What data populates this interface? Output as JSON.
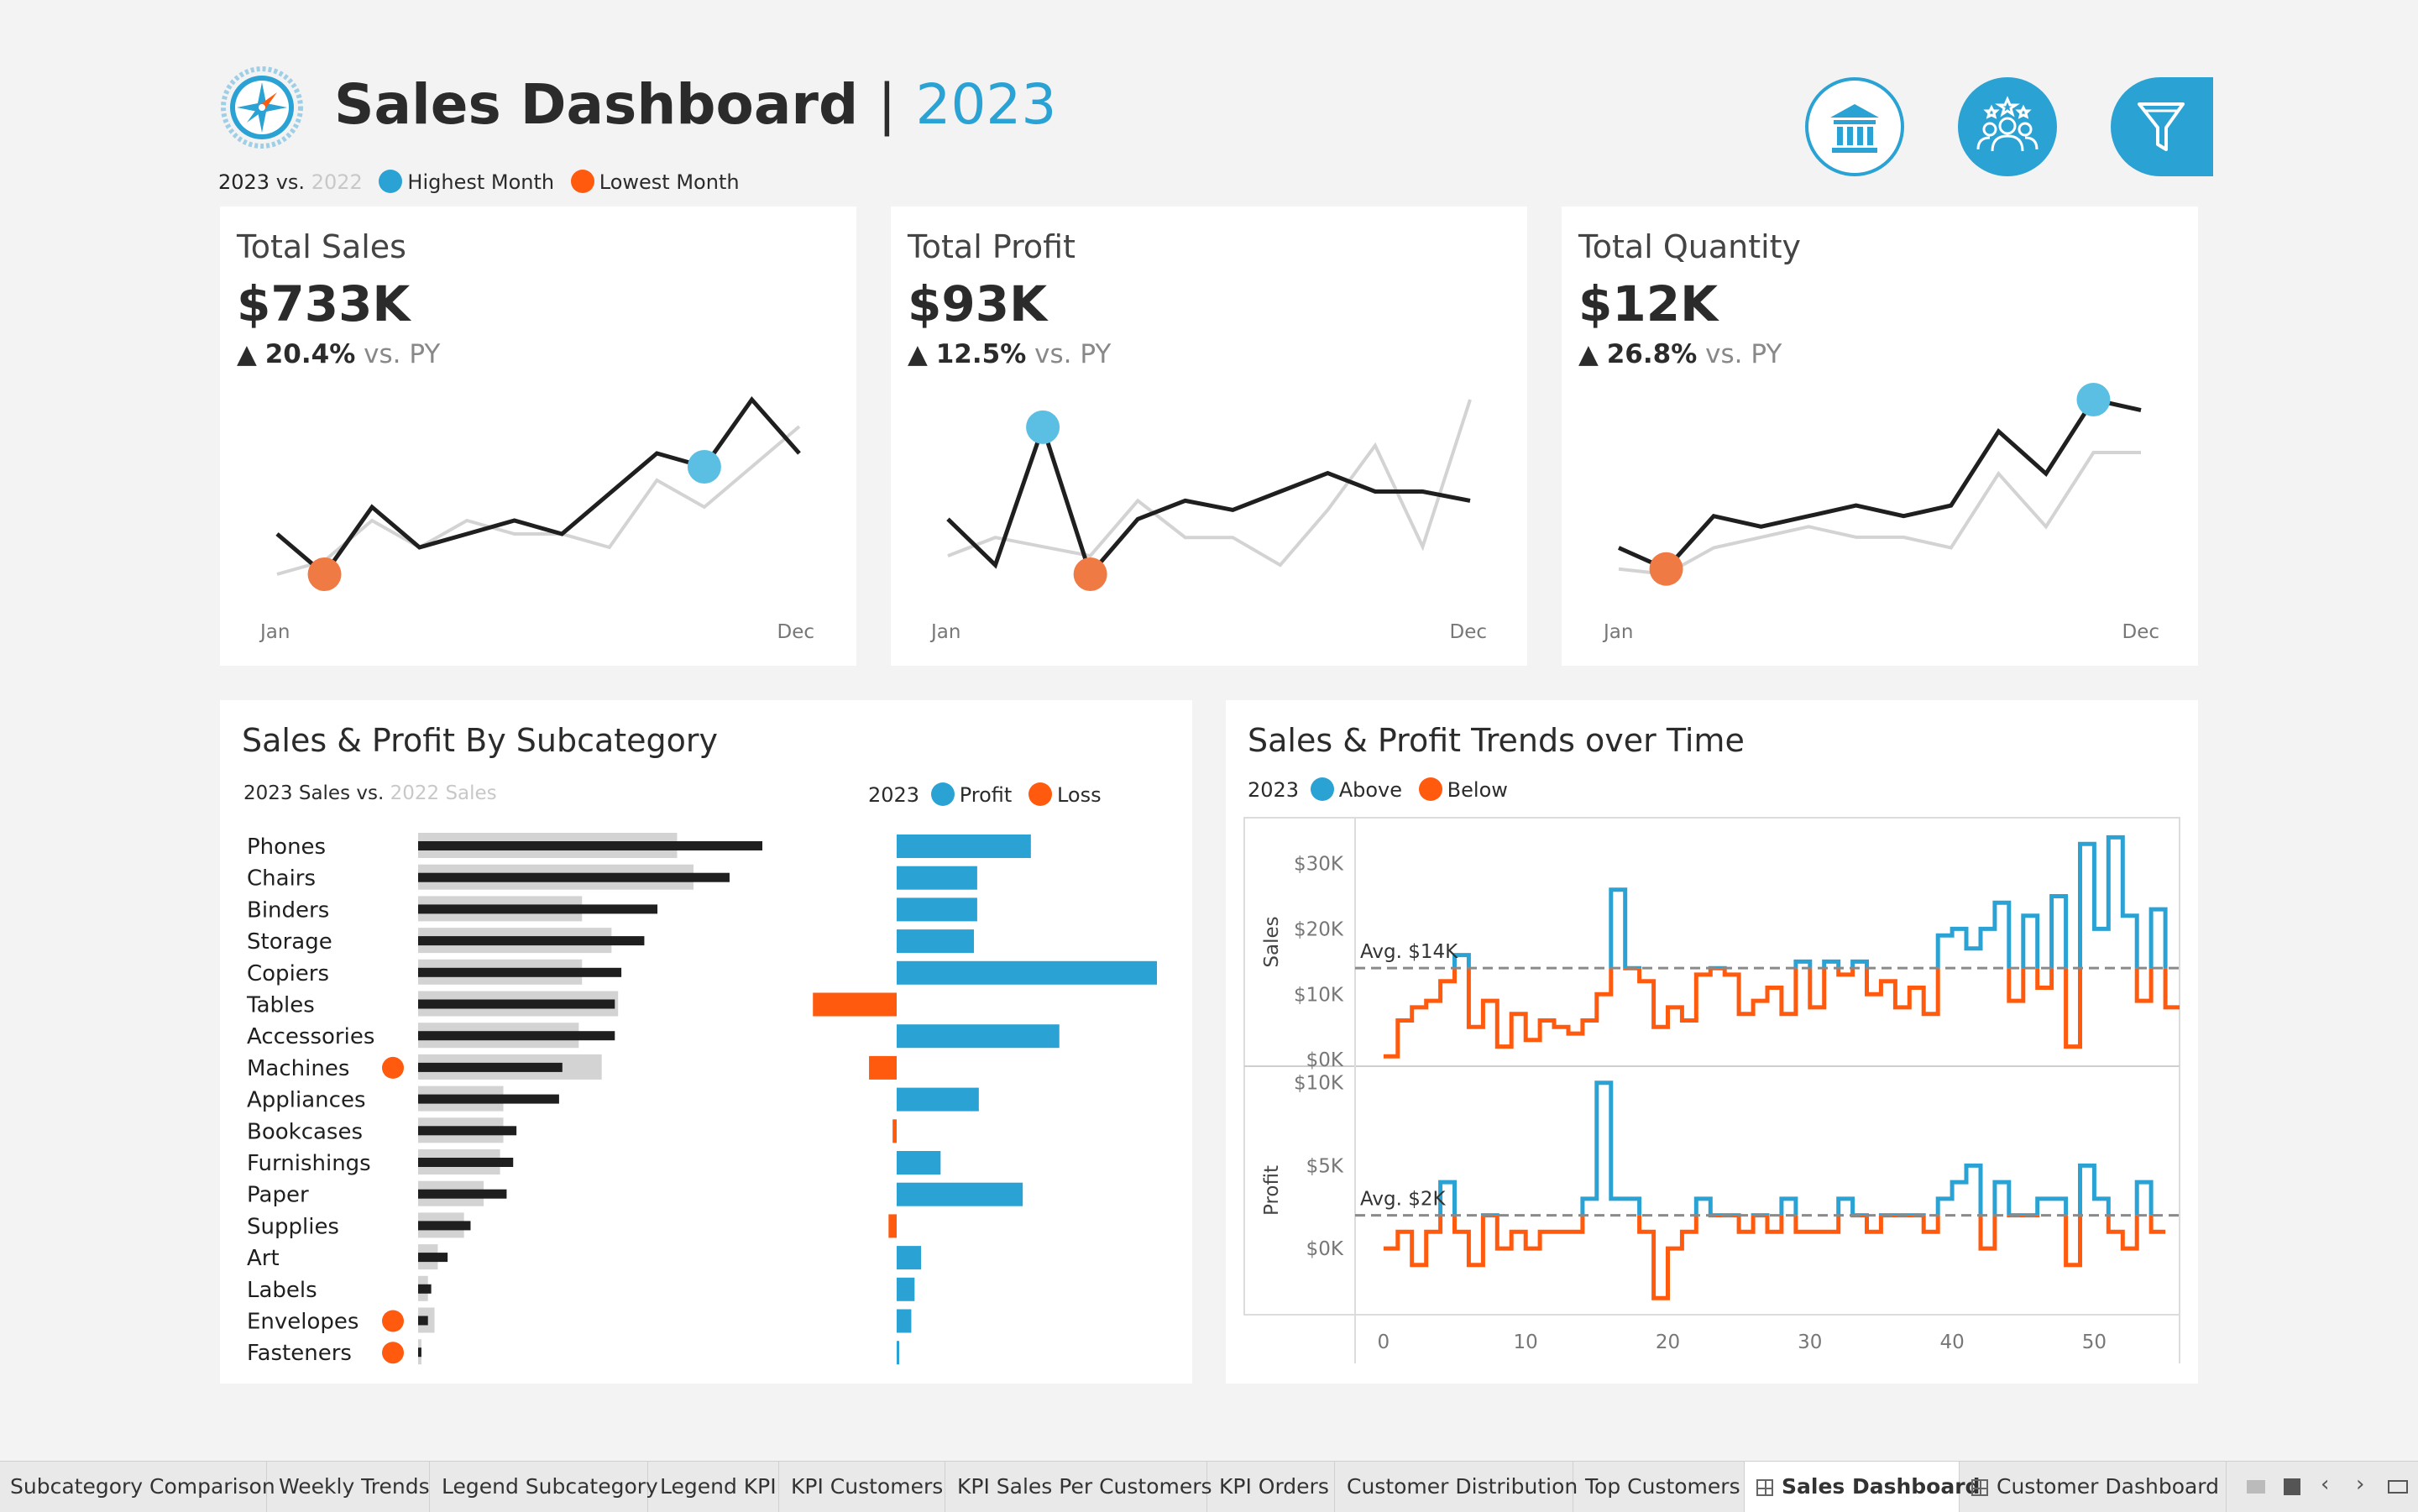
{
  "header": {
    "title": "Sales Dashboard",
    "separator": "|",
    "year": "2023",
    "legend": {
      "current": "2023",
      "vs": "vs.",
      "previous": "2022",
      "highest": "Highest Month",
      "lowest": "Lowest Month"
    }
  },
  "colors": {
    "accent": "#2ba2d4",
    "highlight_blue": "#5bbfe3",
    "loss_orange": "#ff5a0e",
    "low_orange": "#f07a43",
    "prev_gray": "#d3d3d3",
    "current_black": "#1f1f1f"
  },
  "nav_icons": [
    "bank-icon",
    "customers-icon",
    "filter-icon"
  ],
  "kpis": [
    {
      "title": "Total Sales",
      "value": "$733K",
      "arrow": "▲",
      "change": "20.4%",
      "vs": "vs. PY",
      "start": "Jan",
      "end": "Dec",
      "current": [
        4,
        1,
        6,
        3,
        4,
        5,
        4,
        7,
        10,
        9,
        14,
        10
      ],
      "previous": [
        1,
        2,
        5,
        3,
        5,
        4,
        4,
        3,
        8,
        6,
        9,
        12
      ],
      "high_index": 9,
      "low_index": 1
    },
    {
      "title": "Total Profit",
      "value": "$93K",
      "arrow": "▲",
      "change": "12.5%",
      "vs": "vs. PY",
      "start": "Jan",
      "end": "Dec",
      "current": [
        7,
        2,
        17,
        1,
        7,
        9,
        8,
        10,
        12,
        10,
        10,
        9
      ],
      "previous": [
        3,
        5,
        4,
        3,
        9,
        5,
        5,
        2,
        8,
        15,
        4,
        20
      ],
      "high_index": 2,
      "low_index": 3
    },
    {
      "title": "Total Quantity",
      "value": "$12K",
      "arrow": "▲",
      "change": "26.8%",
      "vs": "vs. PY",
      "start": "Jan",
      "end": "Dec",
      "current": [
        3,
        1,
        6,
        5,
        6,
        7,
        6,
        7,
        14,
        10,
        17,
        16
      ],
      "previous": [
        1,
        0.5,
        3,
        4,
        5,
        4,
        4,
        3,
        10,
        5,
        12,
        12
      ],
      "high_index": 10,
      "low_index": 1
    }
  ],
  "subcategory_panel": {
    "title": "Sales & Profit By Subcategory",
    "legend_left": {
      "current": "2023 Sales",
      "vs": "vs.",
      "previous": "2022 Sales"
    },
    "legend_right": {
      "year": "2023",
      "profit": "Profit",
      "loss": "Loss"
    }
  },
  "chart_data": [
    {
      "type": "bar",
      "title": "Sales & Profit By Subcategory",
      "categories": [
        "Phones",
        "Chairs",
        "Binders",
        "Storage",
        "Copiers",
        "Tables",
        "Accessories",
        "Machines",
        "Appliances",
        "Bookcases",
        "Furnishings",
        "Paper",
        "Supplies",
        "Art",
        "Labels",
        "Envelopes",
        "Fasteners"
      ],
      "series": [
        {
          "name": "2023 Sales",
          "values": [
            105,
            95,
            73,
            69,
            62,
            60,
            60,
            44,
            43,
            30,
            29,
            27,
            16,
            9,
            4,
            3,
            1
          ]
        },
        {
          "name": "2022 Sales",
          "values": [
            79,
            84,
            50,
            59,
            50,
            61,
            49,
            56,
            26,
            26,
            25,
            20,
            14,
            6,
            3,
            5,
            1
          ]
        },
        {
          "name": "Profit",
          "values": [
            16.5,
            9.9,
            9.9,
            9.5,
            32,
            -10.3,
            20,
            -3.4,
            10.1,
            -0.5,
            5.4,
            15.5,
            -1,
            3,
            2.2,
            1.8,
            0.3
          ]
        }
      ],
      "decline_flags": [
        false,
        false,
        false,
        false,
        false,
        false,
        false,
        true,
        false,
        false,
        false,
        false,
        false,
        false,
        false,
        true,
        true
      ]
    },
    {
      "type": "line",
      "title": "Sales & Profit Trends over Time",
      "xlabel": "",
      "x_ticks": [
        "0",
        "10",
        "20",
        "30",
        "40",
        "50"
      ],
      "xlim": [
        -2,
        56
      ],
      "panels": [
        {
          "ylabel": "Sales",
          "y_ticks": [
            "$30K",
            "$20K",
            "$10K",
            "$0K"
          ],
          "ylim": [
            -1,
            37
          ],
          "average": 14,
          "average_label": "Avg. $14K",
          "values": [
            0.5,
            6,
            8,
            9,
            12,
            16,
            5,
            9,
            2,
            7,
            3,
            6,
            5,
            4,
            6,
            10,
            26,
            14,
            12,
            5,
            8,
            6,
            13,
            14,
            13,
            7,
            9,
            11,
            7,
            15,
            8,
            15,
            13,
            15,
            10,
            12,
            8,
            11,
            7,
            19,
            20,
            17,
            20,
            24,
            9,
            22,
            11,
            25,
            2,
            33,
            20,
            34,
            22,
            9,
            23,
            8
          ]
        },
        {
          "ylabel": "Profit",
          "y_ticks": [
            "$10K",
            "$5K",
            "$0K"
          ],
          "ylim": [
            -4,
            11
          ],
          "average": 2,
          "average_label": "Avg. $2K",
          "values": [
            0,
            1,
            -1,
            1,
            4,
            1,
            -1,
            2,
            0,
            1,
            0,
            1,
            1,
            1,
            3,
            10,
            3,
            3,
            1,
            -3,
            0,
            1,
            3,
            2,
            2,
            1,
            2,
            1,
            3,
            1,
            1,
            1,
            3,
            2,
            1,
            2,
            2,
            2,
            1,
            3,
            4,
            5,
            0,
            4,
            2,
            2,
            3,
            3,
            -1,
            5,
            3,
            1,
            0,
            4,
            1
          ]
        }
      ]
    }
  ],
  "trends_panel": {
    "title": "Sales & Profit Trends over Time",
    "legend": {
      "year": "2023",
      "above": "Above",
      "below": "Below"
    }
  },
  "tabs": [
    "Subcategory Comparison",
    "Weekly Trends",
    "Legend Subcategory",
    "Legend KPI",
    "KPI Customers",
    "KPI Sales Per Customers",
    "KPI Orders",
    "Customer Distribution",
    "Top Customers",
    "Sales Dashboard",
    "Customer Dashboard"
  ],
  "active_tab": "Sales Dashboard"
}
